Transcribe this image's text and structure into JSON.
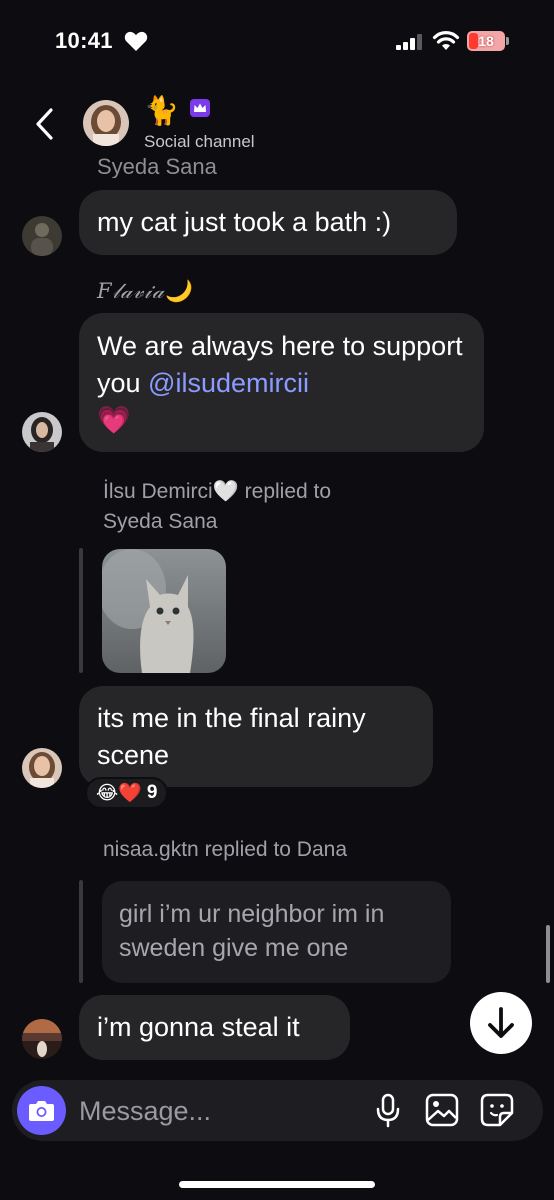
{
  "status_bar": {
    "time": "10:41",
    "battery": "18"
  },
  "header": {
    "back_label": "Back",
    "title_emoji": "🐈",
    "subtitle": "Social channel"
  },
  "messages": {
    "clipped_sender": "Syeda Sana",
    "msg1": {
      "text": "my cat just took a bath :)"
    },
    "msg2": {
      "sender": "𝐹𝓁𝒶𝓋𝒾𝒶🌙",
      "text_before": "We are always here to support you ",
      "mention": "@ilsudemircii",
      "text_after": "💗"
    },
    "msg3": {
      "reply_header_line1": "İlsu Demirci🤍 replied to",
      "reply_header_line2": "Syeda Sana",
      "text": "its me in the final rainy scene",
      "reaction_emojis": "😂❤️",
      "reaction_count": "9"
    },
    "msg4": {
      "reply_header": "nisaa.gktn replied to Dana",
      "quoted_text": "girl i’m ur neighbor im in sweden give me one",
      "text": "i’m gonna steal it"
    }
  },
  "composer": {
    "placeholder": "Message..."
  },
  "colors": {
    "accent": "#6b5cff",
    "mention": "#8c9bff",
    "bubble": "#262629",
    "background": "#0c0c11"
  }
}
